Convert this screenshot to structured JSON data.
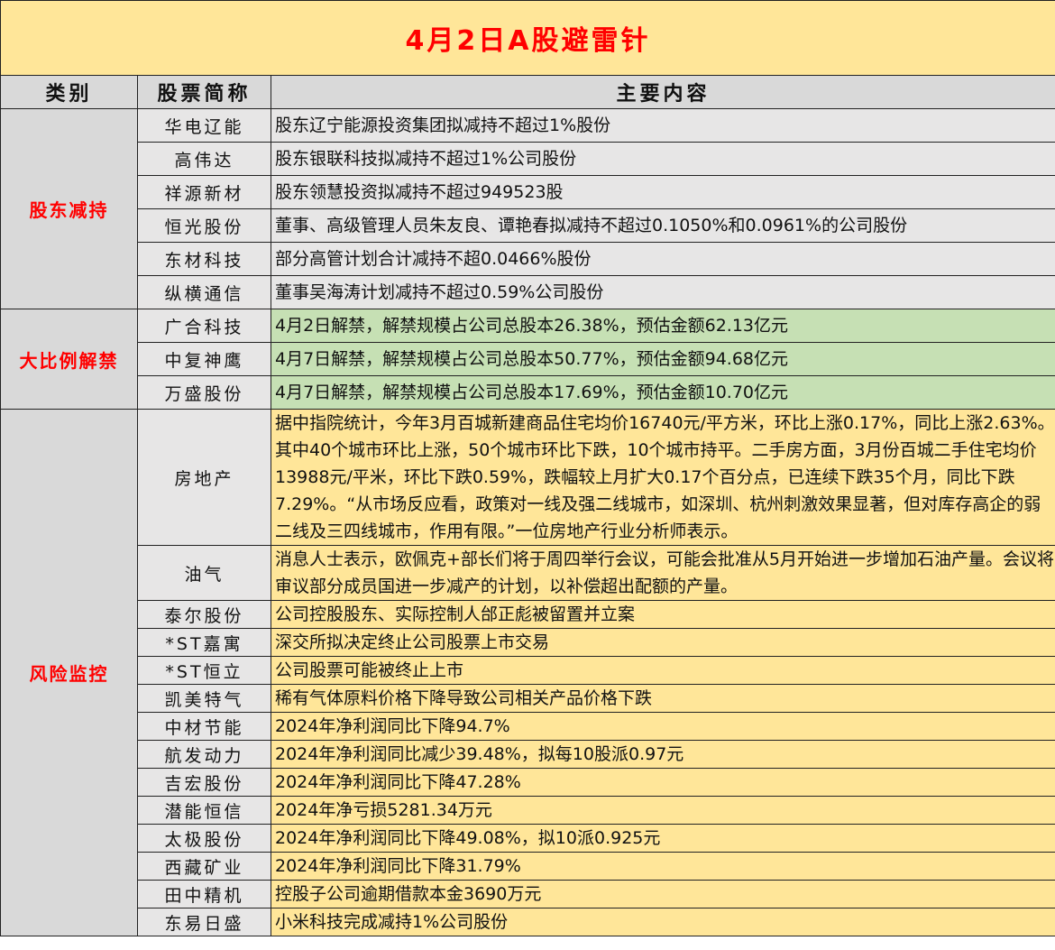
{
  "title": "4月2日A股避雷针",
  "headers": {
    "category": "类别",
    "stock": "股票简称",
    "content": "主要内容"
  },
  "sections": [
    {
      "category": "股东减持",
      "rows": [
        {
          "stock": "华电辽能",
          "content": "股东辽宁能源投资集团拟减持不超过1%股份"
        },
        {
          "stock": "高伟达",
          "content": "股东银联科技拟减持不超过1%公司股份"
        },
        {
          "stock": "祥源新材",
          "content": "股东领慧投资拟减持不超过949523股"
        },
        {
          "stock": "恒光股份",
          "content": "董事、高级管理人员朱友良、谭艳春拟减持不超过0.1050%和0.0961%的公司股份"
        },
        {
          "stock": "东材科技",
          "content": "部分高管计划合计减持不超0.0466%股份"
        },
        {
          "stock": "纵横通信",
          "content": "董事吴海涛计划减持不超过0.59%公司股份"
        }
      ]
    },
    {
      "category": "大比例解禁",
      "rows": [
        {
          "stock": "广合科技",
          "content": "4月2日解禁，解禁规模占公司总股本26.38%，预估金额62.13亿元"
        },
        {
          "stock": "中复神鹰",
          "content": "4月7日解禁，解禁规模占公司总股本50.77%，预估金额94.68亿元"
        },
        {
          "stock": "万盛股份",
          "content": "4月7日解禁，解禁规模占公司总股本17.69%，预估金额10.70亿元"
        }
      ]
    },
    {
      "category": "风险监控",
      "rows": [
        {
          "stock": "房地产",
          "content": "据中指院统计，今年3月百城新建商品住宅均价16740元/平方米，环比上涨0.17%，同比上涨2.63%。其中40个城市环比上涨，50个城市环比下跌，10个城市持平。二手房方面，3月份百城二手住宅均价13988元/平米，环比下跌0.59%，跌幅较上月扩大0.17个百分点，已连续下跌35个月，同比下跌7.29%。“从市场反应看，政策对一线及强二线城市，如深圳、杭州刺激效果显著，但对库存高企的弱二线及三四线城市，作用有限。”一位房地产行业分析师表示。"
        },
        {
          "stock": "油气",
          "content": "消息人士表示，欧佩克+部长们将于周四举行会议，可能会批准从5月开始进一步增加石油产量。会议将审议部分成员国进一步减产的计划，以补偿超出配额的产量。"
        },
        {
          "stock": "泰尔股份",
          "content": "公司控股股东、实际控制人邰正彪被留置并立案"
        },
        {
          "stock": "*ST嘉寓",
          "content": "深交所拟决定终止公司股票上市交易"
        },
        {
          "stock": "*ST恒立",
          "content": "公司股票可能被终止上市"
        },
        {
          "stock": "凯美特气",
          "content": "稀有气体原料价格下降导致公司相关产品价格下跌"
        },
        {
          "stock": "中材节能",
          "content": "2024年净利润同比下降94.7%"
        },
        {
          "stock": "航发动力",
          "content": "2024年净利润同比减少39.48%，拟每10股派0.97元"
        },
        {
          "stock": "吉宏股份",
          "content": "2024年净利润同比下降47.28%"
        },
        {
          "stock": "潜能恒信",
          "content": "2024年净亏损5281.34万元"
        },
        {
          "stock": "太极股份",
          "content": "2024年净利润同比下降49.08%，拟10派0.925元"
        },
        {
          "stock": "西藏矿业",
          "content": "2024年净利润同比下降31.79%"
        },
        {
          "stock": "田中精机",
          "content": "控股子公司逾期借款本金3690万元"
        },
        {
          "stock": "东易日盛",
          "content": "小米科技完成减持1%公司股份"
        }
      ]
    }
  ]
}
